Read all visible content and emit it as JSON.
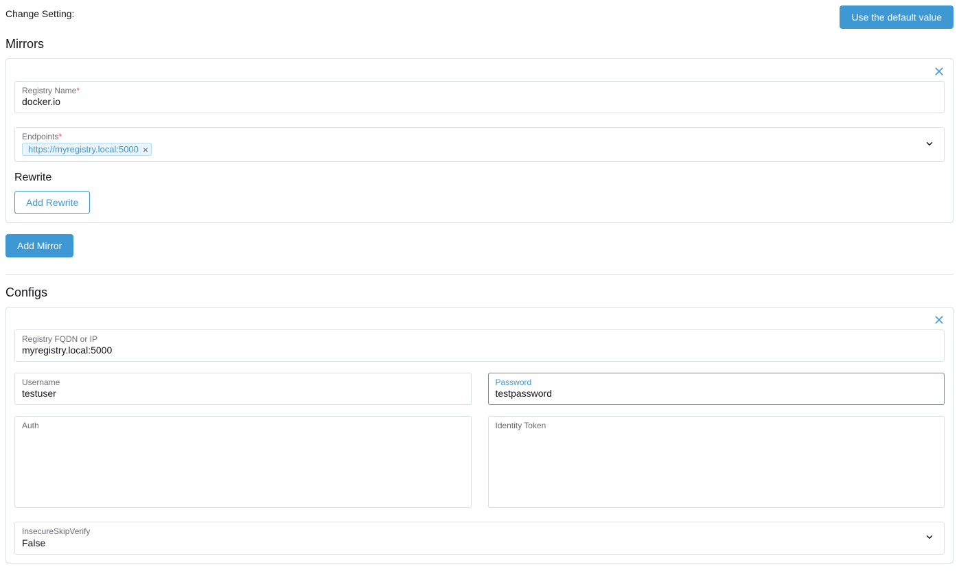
{
  "header": {
    "label": "Change Setting:",
    "default_button": "Use the default value"
  },
  "mirrors": {
    "title": "Mirrors",
    "registry_name": {
      "label": "Registry Name",
      "value": "docker.io"
    },
    "endpoints": {
      "label": "Endpoints",
      "tags": [
        "https://myregistry.local:5000"
      ]
    },
    "rewrite": {
      "title": "Rewrite",
      "add_label": "Add Rewrite"
    },
    "add_mirror_label": "Add Mirror"
  },
  "configs": {
    "title": "Configs",
    "fqdn": {
      "label": "Registry FQDN or IP",
      "value": "myregistry.local:5000"
    },
    "username": {
      "label": "Username",
      "value": "testuser"
    },
    "password": {
      "label": "Password",
      "value": "testpassword"
    },
    "auth": {
      "label": "Auth",
      "value": ""
    },
    "identity_token": {
      "label": "Identity Token",
      "value": ""
    },
    "insecure_skip_verify": {
      "label": "InsecureSkipVerify",
      "value": "False"
    }
  }
}
